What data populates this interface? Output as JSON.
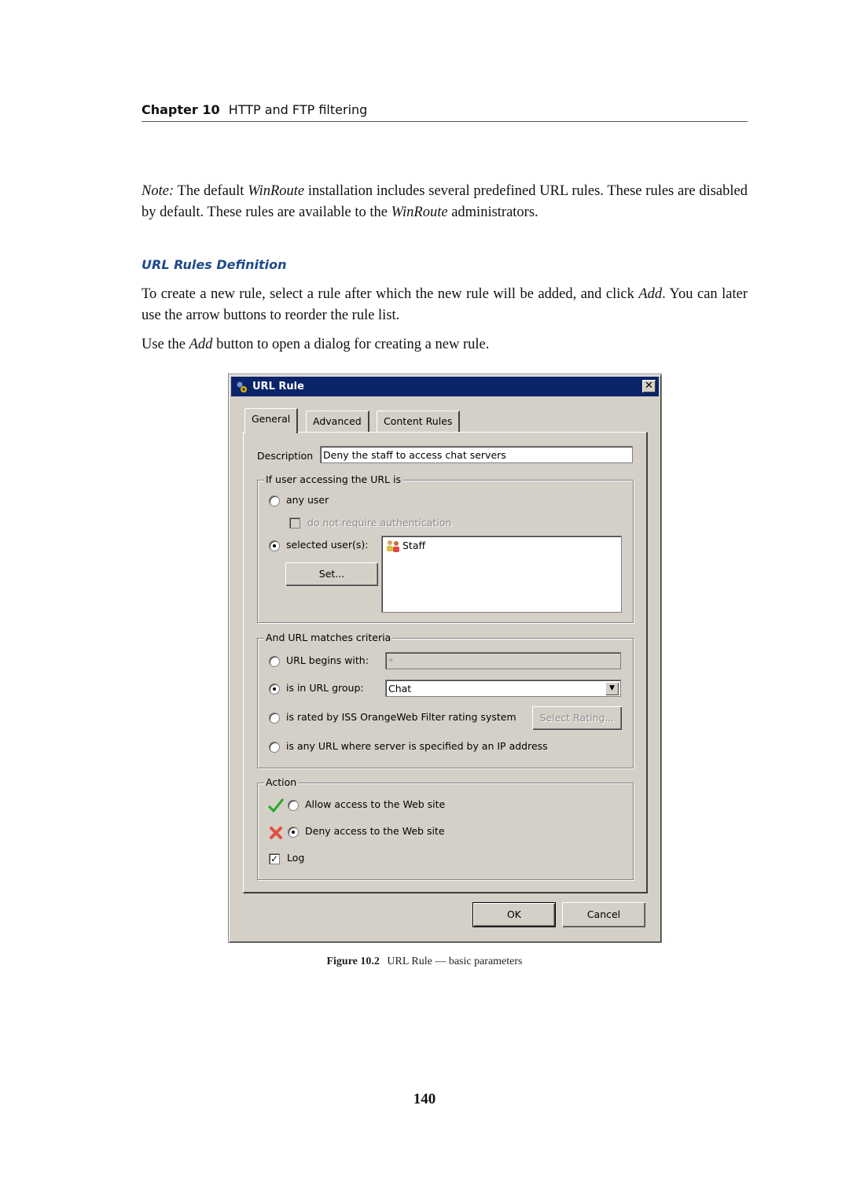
{
  "header": {
    "chapter_label": "Chapter 10",
    "chapter_title": "HTTP and FTP filtering"
  },
  "note": {
    "prefix": "Note:",
    "t1": " The default ",
    "app1": "WinRoute",
    "t2": " installation includes several predefined URL rules.  These rules are disabled by default. These rules are available to the ",
    "app2": "WinRoute",
    "t3": " administrators."
  },
  "section": {
    "title": "URL Rules Definition"
  },
  "para1": {
    "t1": "To create a new rule, select a rule after which the new rule will be added, and click ",
    "em": "Add",
    "t2": ". You can later use the arrow buttons to reorder the rule list."
  },
  "para2": {
    "t1": "Use the ",
    "em": "Add",
    "t2": " button to open a dialog for creating a new rule."
  },
  "dialog": {
    "title": "URL Rule",
    "close_label": "✕",
    "tabs": [
      {
        "label": "General",
        "active": true
      },
      {
        "label": "Advanced",
        "active": false
      },
      {
        "label": "Content Rules",
        "active": false
      }
    ],
    "description": {
      "label": "Description",
      "value": "Deny the staff to access chat servers"
    },
    "user_group": {
      "legend": "If user accessing the URL is",
      "any_user": {
        "label": "any user",
        "checked": false
      },
      "no_auth": {
        "label": "do not require authentication",
        "checked": false,
        "disabled": true
      },
      "selected_users": {
        "label": "selected user(s):",
        "checked": true
      },
      "set_button": "Set...",
      "users": [
        {
          "name": "Staff",
          "icon": "user-group-icon"
        }
      ]
    },
    "url_group": {
      "legend": "And URL matches criteria",
      "begins_with": {
        "label": "URL begins with:",
        "value": "*",
        "checked": false
      },
      "in_group": {
        "label": "is in URL group:",
        "value": "Chat",
        "checked": true
      },
      "rated": {
        "label": "is rated by ISS OrangeWeb Filter rating system",
        "checked": false,
        "button": "Select Rating..."
      },
      "ip_url": {
        "label": "is any URL where server is specified by an IP address",
        "checked": false
      }
    },
    "action_group": {
      "legend": "Action",
      "allow": {
        "label": "Allow access to the Web site",
        "checked": false
      },
      "deny": {
        "label": "Deny access to the Web site",
        "checked": true
      },
      "log": {
        "label": "Log",
        "checked": true
      }
    },
    "ok_label": "OK",
    "cancel_label": "Cancel"
  },
  "caption": {
    "label": "Figure 10.2",
    "text": "URL Rule — basic parameters"
  },
  "page_number": "140"
}
